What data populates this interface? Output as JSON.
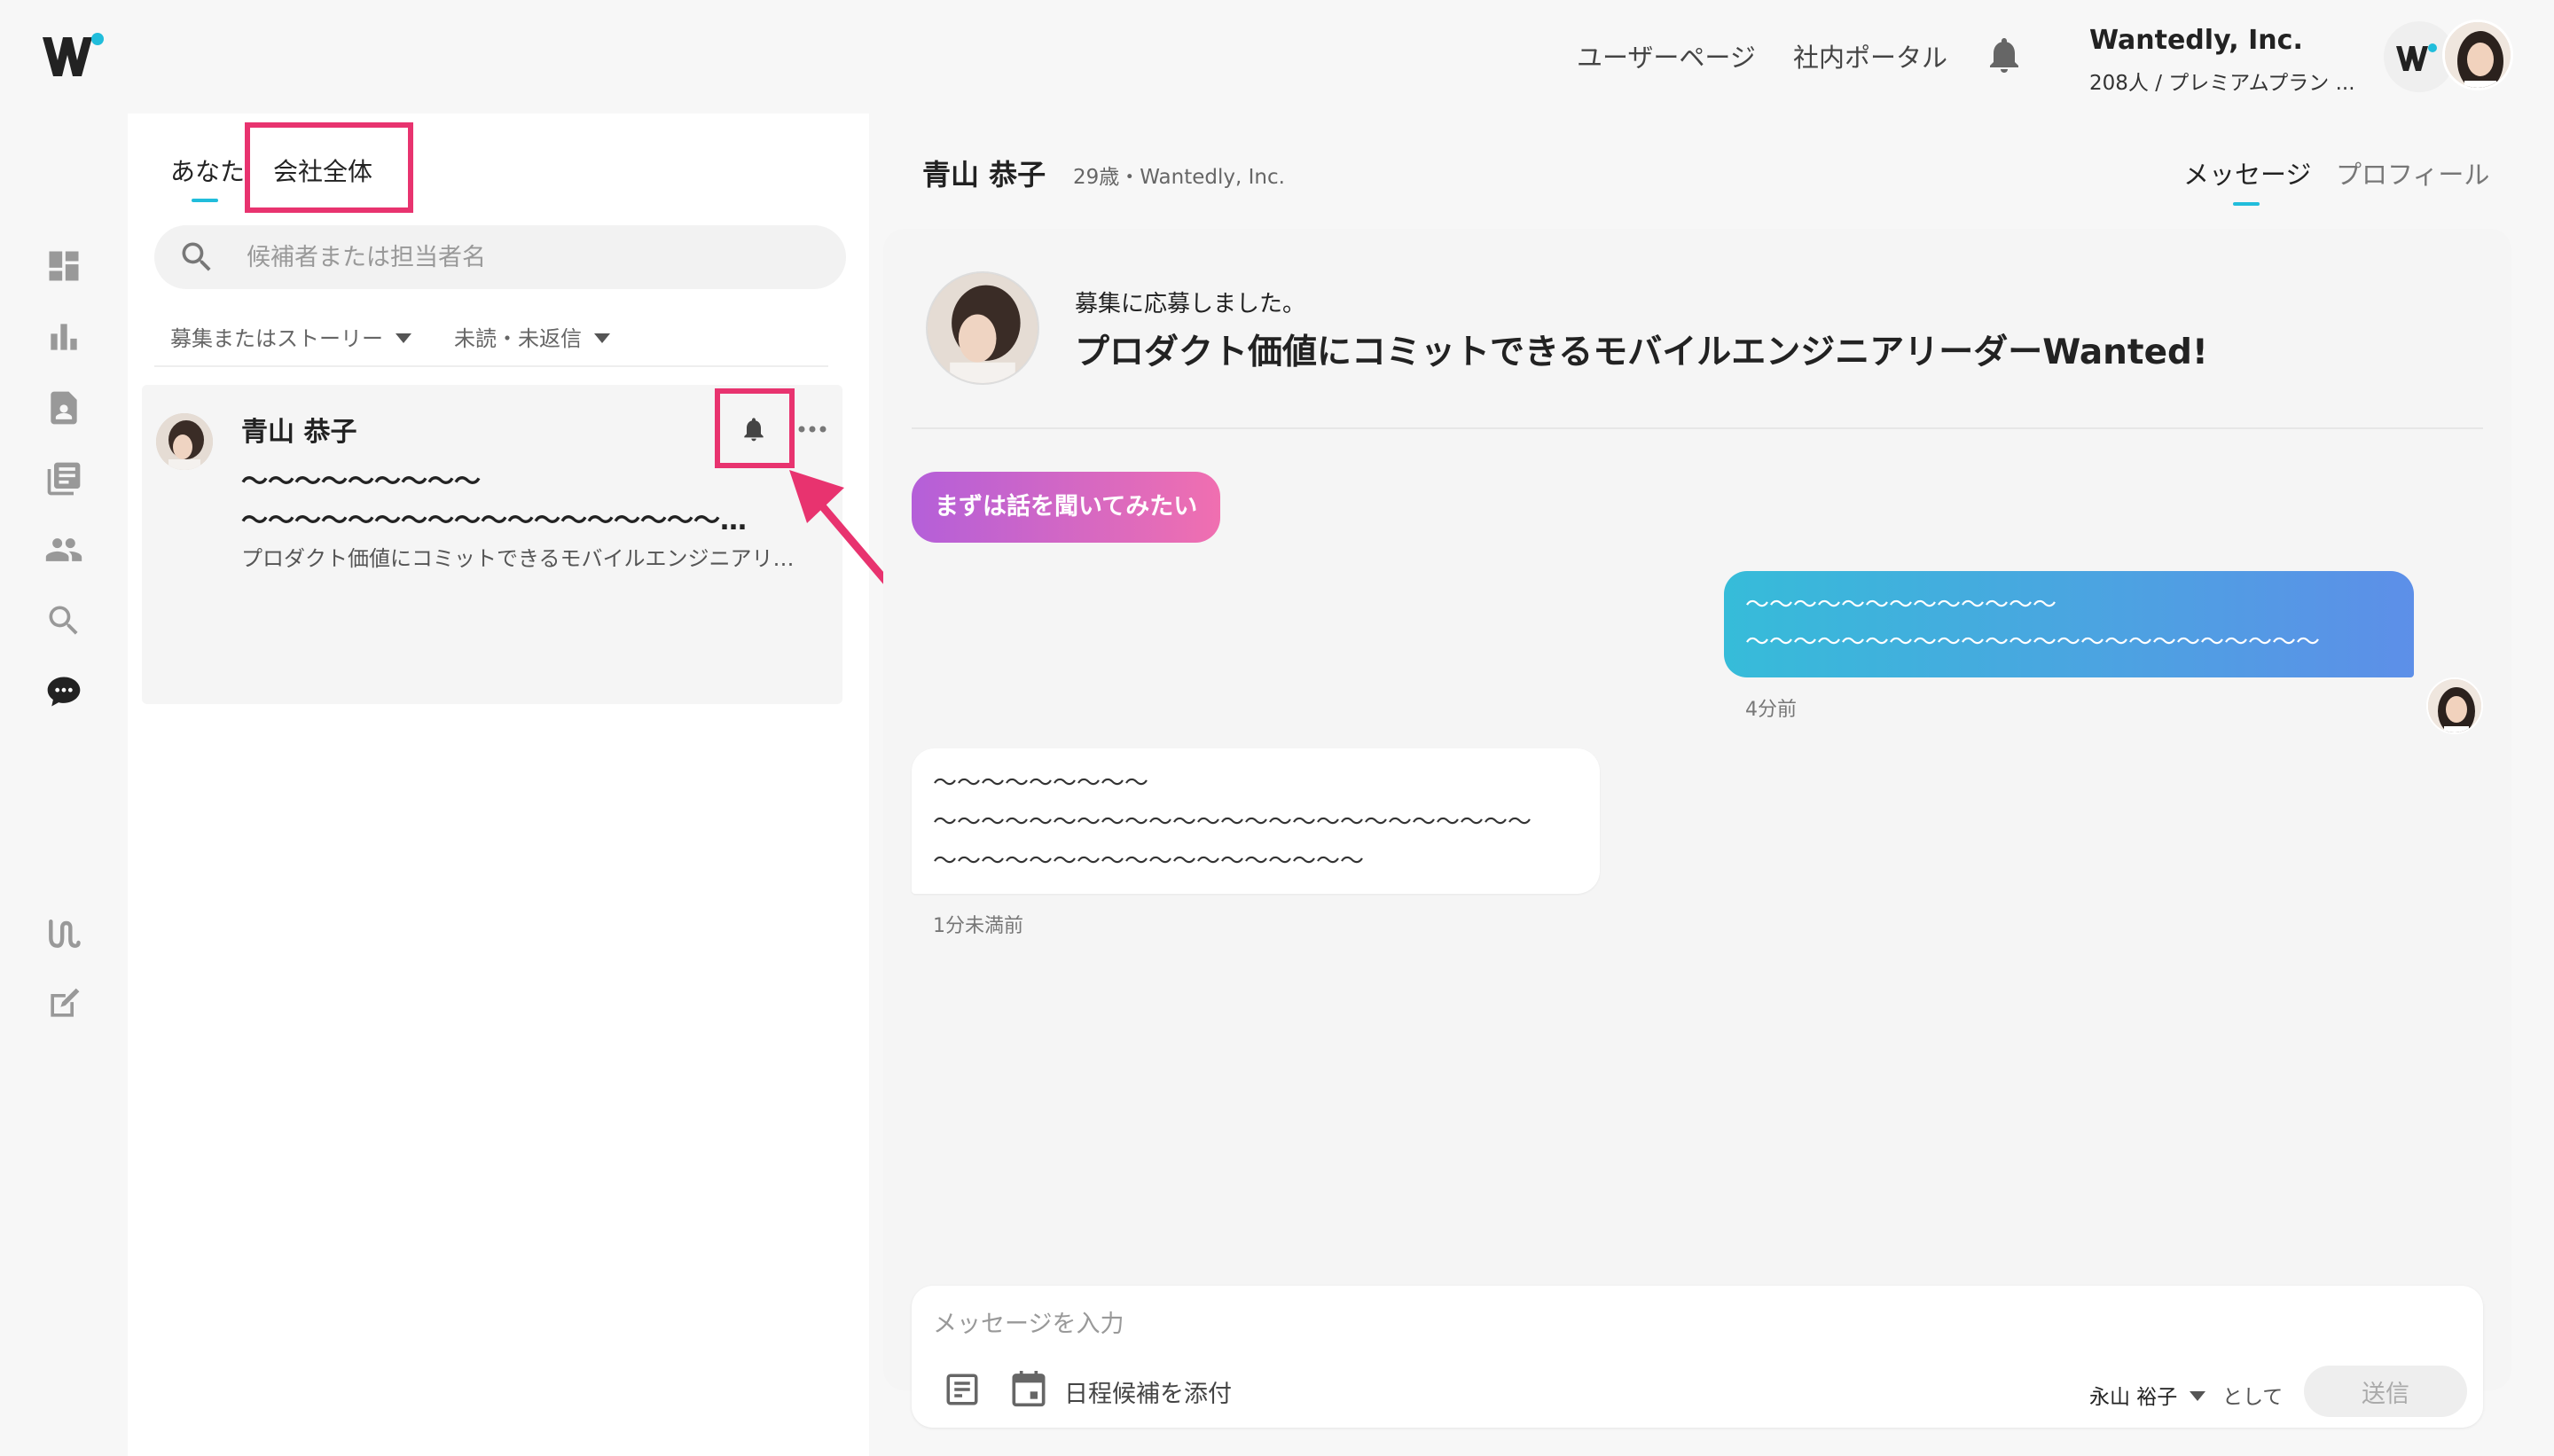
{
  "header": {
    "nav": {
      "user_page": "ユーザーページ",
      "portal": "社内ポータル"
    },
    "company": {
      "name": "Wantedly, Inc.",
      "plan": "208人 / プレミアムプラン ..."
    }
  },
  "rail": {
    "icons": [
      "dashboard-icon",
      "analytics-icon",
      "candidate-icon",
      "stories-icon",
      "members-icon",
      "search-icon",
      "chat-icon",
      "wantedly-story-icon",
      "compose-icon"
    ]
  },
  "left": {
    "tabs": {
      "you": "あなた",
      "company": "会社全体"
    },
    "search": {
      "placeholder": "候補者または担当者名"
    },
    "filters": {
      "recruitment": "募集またはストーリー",
      "status": "未読・未返信"
    },
    "conversation": {
      "name": "青山 恭子",
      "line1": "〜〜〜〜〜〜〜〜〜",
      "line2": "〜〜〜〜〜〜〜〜〜〜〜〜〜〜〜〜〜〜〜...",
      "subtitle": "プロダクト価値にコミットできるモバイルエンジニアリー..."
    }
  },
  "chat": {
    "name": "青山 恭子",
    "meta": "29歳・Wantedly, Inc.",
    "tabs": {
      "messages": "メッセージ",
      "profile": "プロフィール"
    },
    "job": {
      "label": "募集に応募しました。",
      "title": "プロダクト価値にコミットできるモバイルエンジニアリーダーWanted!"
    },
    "interest": "まずは話を聞いてみたい",
    "messages": [
      {
        "line1": "〜〜〜〜〜〜〜〜〜〜〜〜〜",
        "line2": "〜〜〜〜〜〜〜〜〜〜〜〜〜〜〜〜〜〜〜〜〜〜〜〜",
        "time": "4分前"
      },
      {
        "line1": "〜〜〜〜〜〜〜〜〜",
        "line2": "〜〜〜〜〜〜〜〜〜〜〜〜〜〜〜〜〜〜〜〜〜〜〜〜〜",
        "line3": "〜〜〜〜〜〜〜〜〜〜〜〜〜〜〜〜〜〜",
        "time": "1分未満前"
      }
    ],
    "composer": {
      "placeholder": "メッセージを入力",
      "attach_schedule": "日程候補を添付",
      "sender": "永山 裕子",
      "as": "として",
      "send": "送信"
    }
  },
  "colors": {
    "accent": "#21bddb",
    "highlight": "#e8336f",
    "chip_start": "#b45fd9",
    "chip_end": "#f06fb0",
    "bubble_start": "#36bcd9",
    "bubble_end": "#5d8fe8"
  }
}
